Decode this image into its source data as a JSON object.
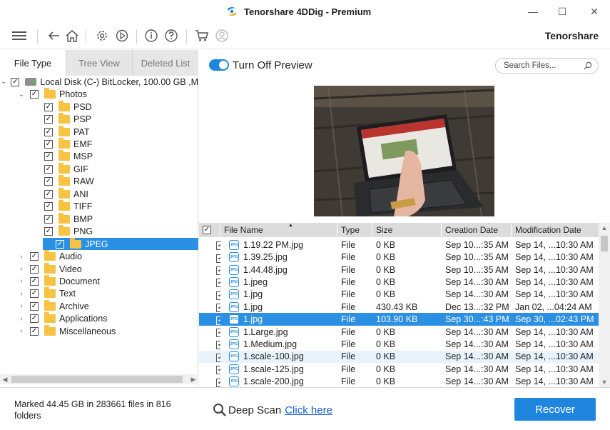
{
  "window": {
    "title": "Tenorshare 4DDig - Premium",
    "minimize": "—",
    "maximize": "☐",
    "close": "✕"
  },
  "toolbar": {
    "brand": "Tenorshare",
    "icons": [
      "menu-icon",
      "back-icon",
      "home-icon",
      "settings-icon",
      "resume-icon",
      "info-icon",
      "help-icon",
      "cart-icon",
      "account-icon"
    ]
  },
  "left_tabs": [
    {
      "label": "File Type",
      "active": true
    },
    {
      "label": "Tree View",
      "active": false
    },
    {
      "label": "Deleted List",
      "active": false
    }
  ],
  "tree": [
    {
      "label": "Local Disk (C-) BitLocker, 100.00 GB ,M",
      "level": 0,
      "expander": "⌄",
      "icon": "drive",
      "checked": true
    },
    {
      "label": "Photos",
      "level": 1,
      "expander": "⌄",
      "icon": "folder",
      "checked": true
    },
    {
      "label": "PSD",
      "level": 2,
      "expander": "",
      "icon": "folder",
      "checked": true
    },
    {
      "label": "PSP",
      "level": 2,
      "expander": "",
      "icon": "folder",
      "checked": true
    },
    {
      "label": "PAT",
      "level": 2,
      "expander": "",
      "icon": "folder",
      "checked": true
    },
    {
      "label": "EMF",
      "level": 2,
      "expander": "",
      "icon": "folder",
      "checked": true
    },
    {
      "label": "MSP",
      "level": 2,
      "expander": "",
      "icon": "folder",
      "checked": true
    },
    {
      "label": "GIF",
      "level": 2,
      "expander": "",
      "icon": "folder",
      "checked": true
    },
    {
      "label": "RAW",
      "level": 2,
      "expander": "",
      "icon": "folder",
      "checked": true
    },
    {
      "label": "ANI",
      "level": 2,
      "expander": "",
      "icon": "folder",
      "checked": true
    },
    {
      "label": "TIFF",
      "level": 2,
      "expander": "",
      "icon": "folder",
      "checked": true
    },
    {
      "label": "BMP",
      "level": 2,
      "expander": "",
      "icon": "folder",
      "checked": true
    },
    {
      "label": "PNG",
      "level": 2,
      "expander": "",
      "icon": "folder",
      "checked": true
    },
    {
      "label": "JPEG",
      "level": 2,
      "expander": "",
      "icon": "folder",
      "checked": true,
      "selected": true
    },
    {
      "label": "Audio",
      "level": 1,
      "expander": "›",
      "icon": "folder",
      "checked": true
    },
    {
      "label": "Video",
      "level": 1,
      "expander": "›",
      "icon": "folder",
      "checked": true
    },
    {
      "label": "Document",
      "level": 1,
      "expander": "›",
      "icon": "folder",
      "checked": true
    },
    {
      "label": "Text",
      "level": 1,
      "expander": "›",
      "icon": "folder",
      "checked": true
    },
    {
      "label": "Archive",
      "level": 1,
      "expander": "›",
      "icon": "folder",
      "checked": true
    },
    {
      "label": "Applications",
      "level": 1,
      "expander": "›",
      "icon": "folder",
      "checked": true
    },
    {
      "label": "Miscellaneous",
      "level": 1,
      "expander": "›",
      "icon": "folder",
      "checked": true
    }
  ],
  "preview": {
    "toggle_label": "Turn Off Preview",
    "toggle_on": true,
    "search_placeholder": "Search Files..."
  },
  "table": {
    "columns": [
      "File Name",
      "Type",
      "Size",
      "Creation Date",
      "Modification Date"
    ],
    "sort_indicator": "▲",
    "icon_text": "JPG",
    "check_mark": "✓",
    "rows": [
      {
        "name": "1.19.22 PM.jpg",
        "type": "File",
        "size": "0 KB",
        "created": "Sep 10...:35 AM",
        "modified": "Sep 14, ...10:30 AM",
        "state": ""
      },
      {
        "name": "1.39.25.jpg",
        "type": "File",
        "size": "0 KB",
        "created": "Sep 10...:35 AM",
        "modified": "Sep 14, ...10:30 AM",
        "state": ""
      },
      {
        "name": "1.44.48.jpg",
        "type": "File",
        "size": "0 KB",
        "created": "Sep 10...:35 AM",
        "modified": "Sep 14, ...10:30 AM",
        "state": ""
      },
      {
        "name": "1.jpeg",
        "type": "File",
        "size": "0 KB",
        "created": "Sep 14...:30 AM",
        "modified": "Sep 14, ...10:30 AM",
        "state": ""
      },
      {
        "name": "1.jpg",
        "type": "File",
        "size": "0 KB",
        "created": "Sep 14...:30 AM",
        "modified": "Sep 14, ...10:30 AM",
        "state": ""
      },
      {
        "name": "1.jpg",
        "type": "File",
        "size": "430.43 KB",
        "created": "Dec 13...:32 PM",
        "modified": "Jan 02, ...04:24 AM",
        "state": ""
      },
      {
        "name": "1.jpg",
        "type": "File",
        "size": "103.90 KB",
        "created": "Sep 30...:43 PM",
        "modified": "Sep 30, ...02:43 PM",
        "state": "selected"
      },
      {
        "name": "1.Large.jpg",
        "type": "File",
        "size": "0 KB",
        "created": "Sep 14...:30 AM",
        "modified": "Sep 14, ...10:30 AM",
        "state": ""
      },
      {
        "name": "1.Medium.jpg",
        "type": "File",
        "size": "0 KB",
        "created": "Sep 14...:30 AM",
        "modified": "Sep 14, ...10:30 AM",
        "state": ""
      },
      {
        "name": "1.scale-100.jpg",
        "type": "File",
        "size": "0 KB",
        "created": "Sep 14...:30 AM",
        "modified": "Sep 14, ...10:30 AM",
        "state": "hover"
      },
      {
        "name": "1.scale-125.jpg",
        "type": "File",
        "size": "0 KB",
        "created": "Sep 14...:30 AM",
        "modified": "Sep 14, ...10:30 AM",
        "state": ""
      },
      {
        "name": "1.scale-200.jpg",
        "type": "File",
        "size": "0 KB",
        "created": "Sep 14...:30 AM",
        "modified": "Sep 14, ...10:30 AM",
        "state": ""
      }
    ]
  },
  "footer": {
    "status": "Marked 44.45 GB in 283661 files in 816 folders",
    "deep_scan_label": "Deep Scan",
    "deep_scan_link": "Click here",
    "recover_label": "Recover"
  },
  "colors": {
    "accent": "#1f86e0",
    "selection": "#2b8fe3",
    "folder": "#f6c342",
    "link": "#1a5fd0"
  }
}
